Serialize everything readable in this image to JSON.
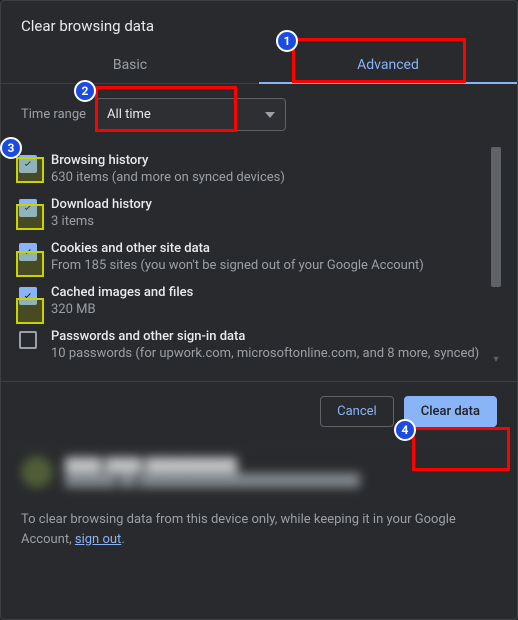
{
  "title": "Clear browsing data",
  "tabs": {
    "basic": "Basic",
    "advanced": "Advanced"
  },
  "time": {
    "label": "Time range",
    "value": "All time"
  },
  "items": [
    {
      "title": "Browsing history",
      "sub": "630 items (and more on synced devices)",
      "checked": true
    },
    {
      "title": "Download history",
      "sub": "3 items",
      "checked": true
    },
    {
      "title": "Cookies and other site data",
      "sub": "From 185 sites (you won't be signed out of your Google Account)",
      "checked": true
    },
    {
      "title": "Cached images and files",
      "sub": "320 MB",
      "checked": true
    },
    {
      "title": "Passwords and other sign-in data",
      "sub": "10 passwords (for upwork.com, microsoftonline.com, and 8 more, synced)",
      "checked": false
    }
  ],
  "buttons": {
    "cancel": "Cancel",
    "clear": "Clear data"
  },
  "account": {
    "name": "████ ████ ██████████",
    "email": "██████ ██ ██████████████████████████"
  },
  "note_prefix": "To clear browsing data from this device only, while keeping it in your Google Account, ",
  "note_link": "sign out",
  "note_suffix": ".",
  "annotations": {
    "1": "1",
    "2": "2",
    "3": "3",
    "4": "4"
  }
}
